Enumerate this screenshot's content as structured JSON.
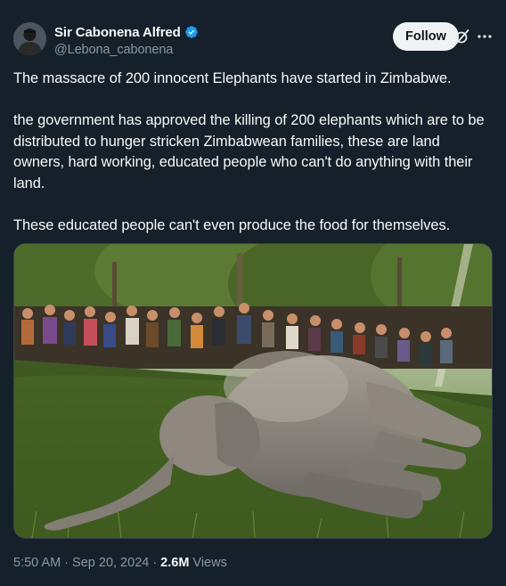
{
  "author": {
    "display_name": "Sir Cabonena Alfred",
    "handle": "@Lebona_cabonena",
    "verified": true,
    "avatar_icon": "avatar-photo"
  },
  "actions": {
    "follow_label": "Follow",
    "grok_icon": "grok-icon",
    "more_icon": "more-icon"
  },
  "tweet": {
    "paragraphs": [
      "The massacre of 200 innocent Elephants have started in Zimbabwe.",
      "the government has approved the killing of 200 elephants which are to be distributed to hunger stricken Zimbabwean families, these are land owners, hard working,  educated people who can't do anything with their land.",
      "These educated people can't even produce the food for themselves."
    ]
  },
  "media": {
    "alt": "Photo of an elephant lying on grass with a crowd behind it"
  },
  "meta": {
    "time": "5:50 AM",
    "date": "Sep 20, 2024",
    "views_count": "2.6M",
    "views_label": "Views",
    "separator": "·"
  },
  "colors": {
    "background": "#15202b",
    "text": "#f7f9f9",
    "secondary": "#8b98a5",
    "verified": "#1d9bf0",
    "follow_bg": "#eff3f4"
  }
}
